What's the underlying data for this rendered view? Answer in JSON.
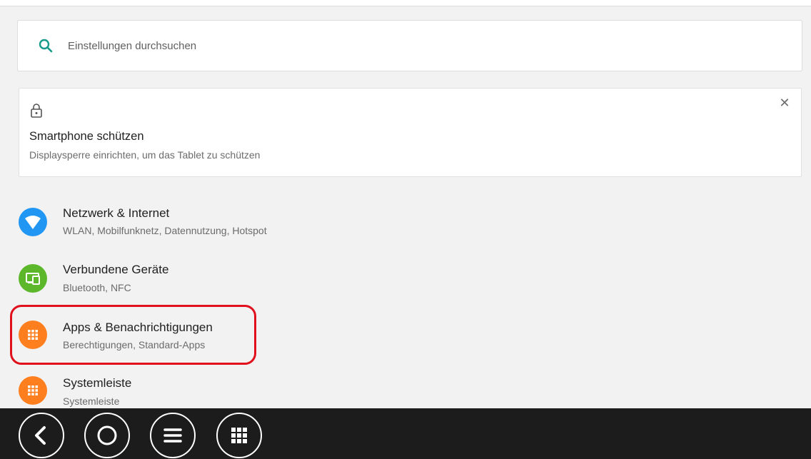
{
  "search": {
    "placeholder": "Einstellungen durchsuchen",
    "icon": "search-icon"
  },
  "suggestion": {
    "title": "Smartphone schützen",
    "summary": "Displaysperre einrichten, um das Tablet zu schützen",
    "icon": "lock-icon",
    "close_icon": "close-icon"
  },
  "settings_items": [
    {
      "title": "Netzwerk & Internet",
      "summary": "WLAN, Mobilfunknetz, Datennutzung, Hotspot",
      "icon": "wifi-icon",
      "color": "#2196F3"
    },
    {
      "title": "Verbundene Geräte",
      "summary": "Bluetooth, NFC",
      "icon": "connected-devices-icon",
      "color": "#5CB82A"
    },
    {
      "title": "Apps & Benachrichtigungen",
      "summary": "Berechtigungen, Standard-Apps",
      "icon": "apps-grid-icon",
      "color": "#FF7F1F"
    },
    {
      "title": "Systemleiste",
      "summary": "Systemleiste",
      "icon": "apps-grid-icon",
      "color": "#FF7F1F"
    }
  ],
  "highlight_color": "#E0101C",
  "navbar": {
    "buttons": [
      "back-icon",
      "home-icon",
      "menu-icon",
      "app-drawer-icon"
    ]
  }
}
